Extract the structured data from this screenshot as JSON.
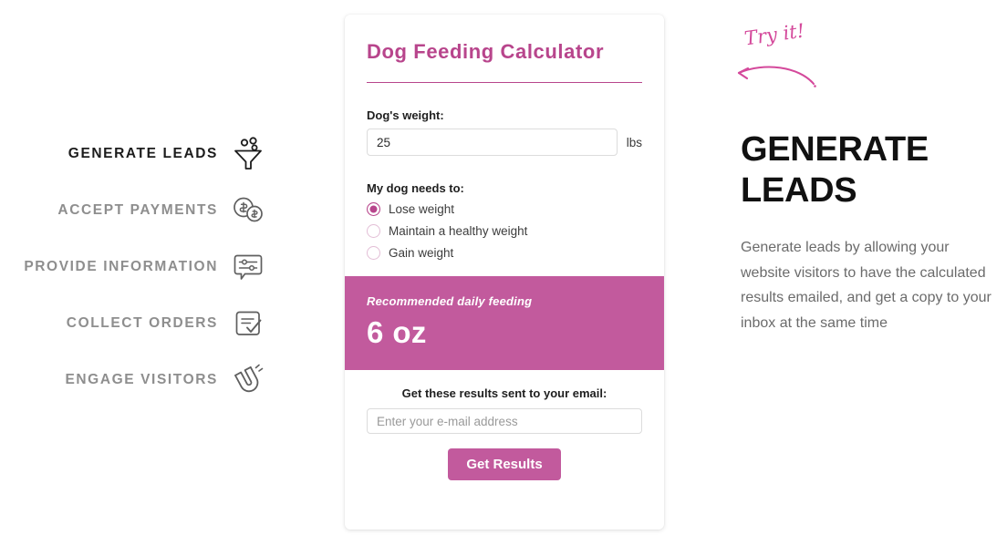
{
  "features": {
    "items": [
      {
        "label": "GENERATE LEADS",
        "icon": "funnel-icon",
        "active": true
      },
      {
        "label": "ACCEPT PAYMENTS",
        "icon": "coins-dollar-icon",
        "active": false
      },
      {
        "label": "PROVIDE INFORMATION",
        "icon": "chat-sliders-icon",
        "active": false
      },
      {
        "label": "COLLECT ORDERS",
        "icon": "document-check-icon",
        "active": false
      },
      {
        "label": "ENGAGE VISITORS",
        "icon": "magnet-icon",
        "active": false
      }
    ]
  },
  "calculator": {
    "title": "Dog Feeding Calculator",
    "weight_label": "Dog's weight:",
    "weight_value": "25",
    "weight_placeholder": "",
    "weight_unit": "lbs",
    "goal_label": "My dog needs to:",
    "goal_options": [
      {
        "label": "Lose weight",
        "checked": true
      },
      {
        "label": "Maintain a healthy weight",
        "checked": false
      },
      {
        "label": "Gain weight",
        "checked": false
      }
    ],
    "result_caption": "Recommended daily feeding",
    "result_value": "6 oz",
    "email_label": "Get these results sent to your email:",
    "email_value": "",
    "email_placeholder": "Enter your e-mail address",
    "submit_label": "Get Results"
  },
  "promo": {
    "try_it": "Try it!",
    "heading": "GENERATE LEADS",
    "body": "Generate leads by allowing your website visitors to have the calculated results emailed, and get a copy to your inbox at the same time"
  },
  "colors": {
    "accent": "#b8458c",
    "banner": "#c25a9d",
    "button": "#c25a9d",
    "script_pink": "#d4499b",
    "muted_text": "#8e8e8e",
    "body_text": "#6b6b6b"
  }
}
